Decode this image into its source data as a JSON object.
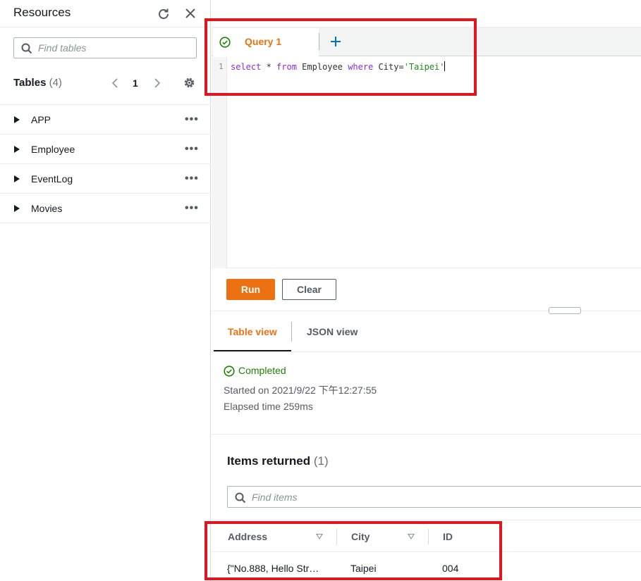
{
  "sidebar": {
    "title": "Resources",
    "search_placeholder": "Find tables",
    "tables_label": "Tables",
    "tables_count": "(4)",
    "page": "1",
    "tables": [
      {
        "name": "APP"
      },
      {
        "name": "Employee"
      },
      {
        "name": "EventLog"
      },
      {
        "name": "Movies"
      }
    ],
    "row_menu": "•••"
  },
  "editor": {
    "tab_label": "Query 1",
    "line_number": "1",
    "query": {
      "select": "select",
      "star": " * ",
      "from": "from",
      "table": " Employee ",
      "where": "where",
      "cond": " City=",
      "value": "'Taipei'"
    }
  },
  "actions": {
    "run_label": "Run",
    "clear_label": "Clear"
  },
  "results": {
    "tab_table": "Table view",
    "tab_json": "JSON view",
    "status": "Completed",
    "started": "Started on 2021/9/22 下午12:27:55",
    "elapsed": "Elapsed time 259ms",
    "items_title": "Items returned",
    "items_count": "(1)",
    "search_placeholder": "Find items",
    "columns": [
      "Address",
      "City",
      "ID"
    ],
    "rows": [
      {
        "address": "{\"No.888, Hello Str…",
        "city": "Taipei",
        "id": "004"
      }
    ]
  },
  "colors": {
    "accent": "#ec7211",
    "success": "#1d8102",
    "annotation": "#e0161e"
  }
}
